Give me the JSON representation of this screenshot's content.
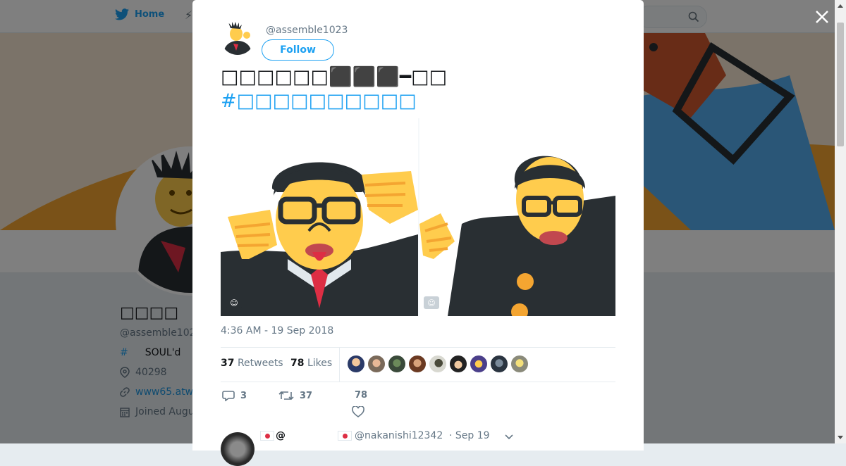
{
  "nav": {
    "home_label": "Home"
  },
  "profile": {
    "name": "□□□□",
    "handle": "@assemble102",
    "bio_label": "SOUL'd",
    "location": "40298",
    "website": "www65.atw",
    "joined": "Joined Augu"
  },
  "tweet": {
    "handle": "@assemble1023",
    "follow_label": "Follow",
    "text": "□□□□□□⬛⬛⬛━□□",
    "hashtag": "#□□□□□□□□□□",
    "timestamp": "4:36 AM - 19 Sep 2018",
    "retweets_count": "37",
    "retweets_label": "Retweets",
    "likes_count": "78",
    "likes_label": "Likes",
    "reply_count": "3",
    "retweet_action_count": "37",
    "like_action_count": "78"
  },
  "reply": {
    "prefix": "@",
    "handle": "@nakanishi12342",
    "date": "· Sep 19"
  },
  "colors": {
    "accent": "#1da1f2",
    "overlay": "rgba(0,0,0,0.5)",
    "emoji_yellow": "#ffcc4d",
    "suit_dark": "#292f33"
  }
}
